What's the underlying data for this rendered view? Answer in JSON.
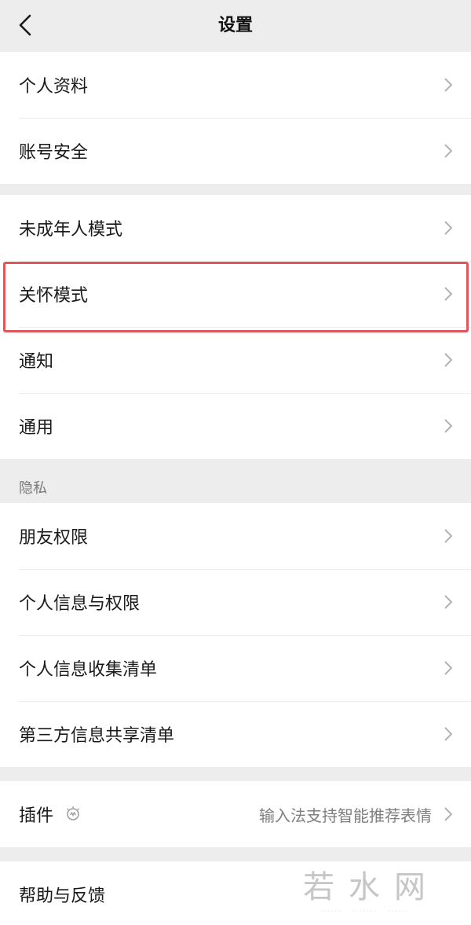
{
  "nav": {
    "title": "设置"
  },
  "group1": [
    {
      "label": "个人资料"
    },
    {
      "label": "账号安全"
    }
  ],
  "group2": [
    {
      "label": "未成年人模式"
    },
    {
      "label": "关怀模式"
    },
    {
      "label": "通知"
    },
    {
      "label": "通用"
    }
  ],
  "privacy": {
    "header": "隐私",
    "items": [
      {
        "label": "朋友权限"
      },
      {
        "label": "个人信息与权限"
      },
      {
        "label": "个人信息收集清单"
      },
      {
        "label": "第三方信息共享清单"
      }
    ]
  },
  "plugins": {
    "label": "插件",
    "icon": "plugin-icon",
    "value": "输入法支持智能推荐表情"
  },
  "help": {
    "label": "帮助与反馈"
  },
  "watermark": {
    "text": "若水网"
  },
  "colors": {
    "background": "#ededed",
    "row": "#ffffff",
    "highlight": "#e0565a",
    "secondary_text": "#7f7f7f"
  }
}
